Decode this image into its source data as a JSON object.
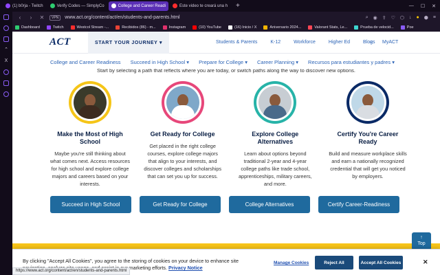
{
  "browser": {
    "tabs": [
      {
        "label": "(1) b0rja - Twitch",
        "color": "#9146ff",
        "active": false
      },
      {
        "label": "Verify Codes — SimplyCo",
        "color": "#2ecc71",
        "active": false
      },
      {
        "label": "College and Career Readi",
        "color": "#2b63b6",
        "active": true
      },
      {
        "label": "Este video te creará una h",
        "color": "#ff2d2d",
        "active": false
      }
    ],
    "new_tab": "+",
    "url": "www.act.org/content/act/en/students-and-parents.html",
    "vpn_label": "VPN",
    "bookmarks": [
      {
        "label": "Dashboard",
        "color": "#2ecc71"
      },
      {
        "label": "Twitch",
        "color": "#9146ff"
      },
      {
        "label": "Westcol Stream -...",
        "color": "#ff2d2d"
      },
      {
        "label": "Recibidos (86) - m...",
        "color": "#ea4335"
      },
      {
        "label": "Instagram",
        "color": "#e1306c"
      },
      {
        "label": "(10) YouTube",
        "color": "#ff0000"
      },
      {
        "label": "(16) Inicio / X",
        "color": "#ffffff"
      },
      {
        "label": "Aniversario 2024...",
        "color": "#f5b400"
      },
      {
        "label": "Valorant Stats, Le...",
        "color": "#ff4655"
      },
      {
        "label": "Prueba de velocid...",
        "color": "#3dd6d0"
      },
      {
        "label": "Poe",
        "color": "#8a5cf6"
      }
    ],
    "status_url": "https://www.act.org/content/act/en/students-and-parents.html"
  },
  "header": {
    "logo": "ACT",
    "journey": "START YOUR JOURNEY",
    "nav": [
      "Students & Parents",
      "K-12",
      "Workforce",
      "Higher Ed",
      "Blogs"
    ],
    "myact": "MyACT"
  },
  "subnav": [
    "College and Career Readiness",
    "Succeed in High School",
    "Prepare for College",
    "Career Planning",
    "Recursos para estudiantes y padres"
  ],
  "intro": "Start by selecting a path that reflects where you are today, or switch paths along the way to discover new options.",
  "cards": [
    {
      "title": "Make the Most of High School",
      "text": "Maybe you're still thinking about what comes next. Access resources for high school and explore college majors and careers based on your interests.",
      "button": "Succeed in High School",
      "ring": "#f5c518",
      "bg": "#3a3a2a",
      "shirt": "#3d2b1f"
    },
    {
      "title": "Get Ready for College",
      "text": "Get placed in the right college courses, explore college majors that align to your interests, and discover colleges and scholarships that can set you up for success.",
      "button": "Get Ready for College",
      "ring": "#e7477a",
      "bg": "#7fa8c9",
      "shirt": "#ffffff"
    },
    {
      "title": "Explore College Alternatives",
      "text": "Learn about options beyond traditional 2-year and 4-year college paths like trade school, apprenticeships, military careers, and more.",
      "button": "College Alternatives",
      "ring": "#27b3a8",
      "bg": "#c7cdd3",
      "shirt": "#4a6a8a"
    },
    {
      "title": "Certify You're Career Ready",
      "text": "Build and measure workplace skills and earn a nationally recognized credential that will get you noticed by employers.",
      "button": "Certify Career-Readiness",
      "ring": "#0a2a66",
      "bg": "#bfd8e8",
      "shirt": "#d9dde2"
    }
  ],
  "to_top": {
    "arrow": "↑",
    "label": "Top"
  },
  "cookie": {
    "text": "By clicking \"Accept All Cookies\", you agree to the storing of cookies on your device to enhance site navigation, analyze site usage, and assist in our marketing efforts.",
    "privacy": "Privacy Notice",
    "manage": "Manage Cookies",
    "reject": "Reject All",
    "accept": "Accept All Cookies",
    "close": "✕"
  }
}
